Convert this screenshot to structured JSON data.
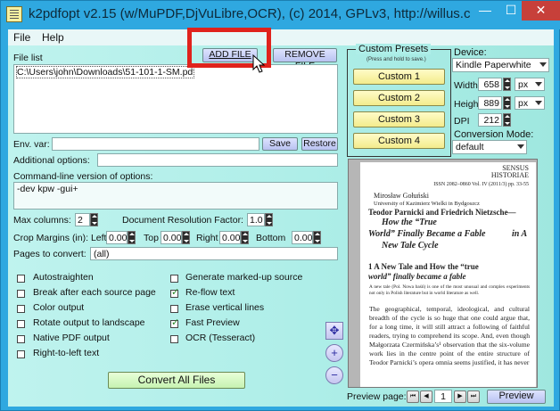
{
  "window": {
    "title": "k2pdfopt v2.15 (w/MuPDF,DjVuLibre,OCR), (c) 2014, GPLv3, http://willus.c...",
    "min_glyph": "—",
    "max_glyph": "☐",
    "close_glyph": "✕"
  },
  "menu": {
    "file": "File",
    "help": "Help"
  },
  "file_list": {
    "label": "File list",
    "add_button": "ADD FILE",
    "remove_button": "REMOVE FILE",
    "item": "C:\\Users\\john\\Downloads\\51-101-1-SM.pdf"
  },
  "env": {
    "label": "Env. var:",
    "save_button": "Save",
    "restore_button": "Restore"
  },
  "additional": {
    "label": "Additional options:"
  },
  "cmdline": {
    "label": "Command-line version of options:",
    "value": "-dev kpw -gui+"
  },
  "max_columns": {
    "label": "Max columns:",
    "value": "2"
  },
  "resolution": {
    "label": "Document Resolution Factor:",
    "value": "1.0"
  },
  "crop": {
    "label": "Crop Margins (in): Left",
    "left": "0.00",
    "top_label": "Top",
    "top": "0.00",
    "right_label": "Right",
    "right": "0.00",
    "bottom_label": "Bottom",
    "bottom": "0.00"
  },
  "pages": {
    "label": "Pages to convert:",
    "value": "(all)"
  },
  "options_left": [
    {
      "label": "Autostraighten",
      "checked": false
    },
    {
      "label": "Break after each source page",
      "checked": false
    },
    {
      "label": "Color output",
      "checked": false
    },
    {
      "label": "Rotate output to landscape",
      "checked": false
    },
    {
      "label": "Native PDF output",
      "checked": false
    },
    {
      "label": "Right-to-left text",
      "checked": false
    }
  ],
  "options_right": [
    {
      "label": "Generate marked-up source",
      "checked": false
    },
    {
      "label": "Re-flow text",
      "checked": true
    },
    {
      "label": "Erase vertical lines",
      "checked": false
    },
    {
      "label": "Fast Preview",
      "checked": true
    },
    {
      "label": "OCR (Tesseract)",
      "checked": false
    }
  ],
  "convert_button": "Convert All Files",
  "presets": {
    "title": "Custom Presets",
    "subtitle": "(Press and hold to save.)",
    "buttons": [
      "Custom 1",
      "Custom 2",
      "Custom 3",
      "Custom 4"
    ]
  },
  "device": {
    "label": "Device:",
    "value": "Kindle Paperwhite",
    "width_label": "Width",
    "width": "658",
    "width_unit": "px",
    "height_label": "Height",
    "height": "889",
    "height_unit": "px",
    "dpi_label": "DPI",
    "dpi": "212"
  },
  "conversion_mode": {
    "label": "Conversion Mode:",
    "value": "default"
  },
  "preview_doc": {
    "journal": "SENSUS HISTORIAE",
    "issn": "ISSN 2082–0860 Vol. IV (2011/3) pp. 33-55",
    "author": "Mirosław Gołuński",
    "affiliation": "University of Kazimierz Wielki in Bydgoszcz",
    "title1": "Teodor Parnicki and Friedrich Nietzsche—",
    "title2": "How the “True",
    "title3": "World” Finally Became a Fable",
    "title3b": "in A",
    "title4": "New Tale Cycle",
    "section1": "1 A New Tale and How the “true",
    "section2": "world” finally became a fable",
    "note": "A new tale (Pol. Nowa baśń) is one of the most unusual and complex experiments not only in Polish literature but in world literature as well.",
    "body": "The geographical, temporal, ideological, and cultural breadth of the cycle is so huge that one could argue that, for a long time, it will still attract a following of faithful readers, trying to comprehend its scope. And, even though Małgorzata Czermińska’s¹ observation that the six-volume work lies in the centre point of the entire structure of Teodor Parnicki’s opera omnia seems justified, it has never"
  },
  "preview_controls": {
    "label": "Preview page:",
    "page": "1",
    "preview_button": "Preview",
    "first_glyph": "⏮",
    "prev_glyph": "◀",
    "next_glyph": "▶",
    "last_glyph": "⏭"
  },
  "tools": {
    "move_glyph": "✥",
    "zoom_in_glyph": "+",
    "zoom_out_glyph": "−"
  }
}
